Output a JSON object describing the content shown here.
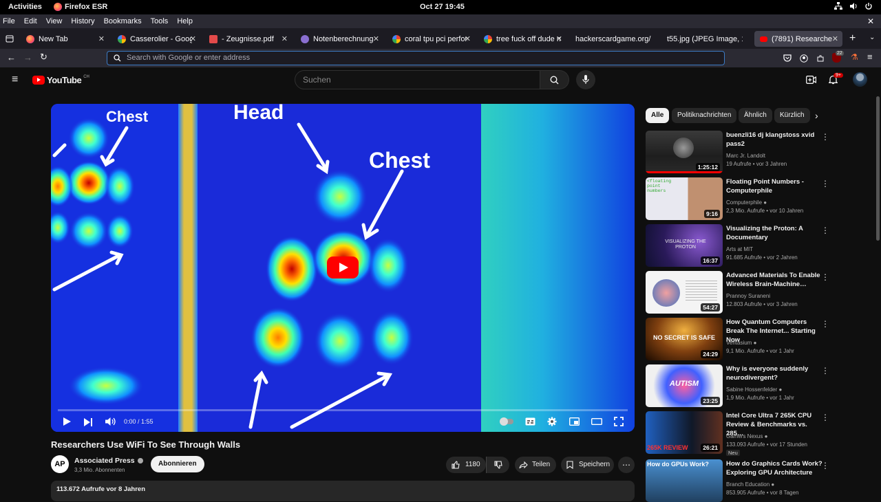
{
  "system": {
    "activities": "Activities",
    "app_name": "Firefox ESR",
    "clock": "Oct 27  19:45"
  },
  "menu": [
    "File",
    "Edit",
    "View",
    "History",
    "Bookmarks",
    "Tools",
    "Help"
  ],
  "tabs": [
    {
      "title": "New Tab"
    },
    {
      "title": "Casserolier - Google S"
    },
    {
      "title": "- Zeugnisse.pdf"
    },
    {
      "title": "Notenberechnung na"
    },
    {
      "title": "coral tpu pci perform"
    },
    {
      "title": "tree fuck off dude me"
    },
    {
      "title": "hackerscardgame.org/1/j"
    },
    {
      "title": "t55.jpg (JPEG Image, 160"
    },
    {
      "title": "(7891) Researchers U"
    }
  ],
  "nav": {
    "url_placeholder": "Search with Google or enter address",
    "notification_count": "22"
  },
  "youtube": {
    "logo": "YouTube",
    "region": "CH",
    "search_placeholder": "Suchen",
    "notif_badge": "9+",
    "video": {
      "title": "Researchers Use WiFi To See Through Walls",
      "time": "0:00 / 1:55",
      "overlay_labels": [
        "Chest",
        "Head",
        "Chest"
      ],
      "progress": 0
    },
    "channel": {
      "name": "Associated Press",
      "avatar_text": "AP",
      "subs": "3,3 Mio. Abonnenten",
      "subscribe": "Abonnieren"
    },
    "actions": {
      "likes": "1180",
      "share": "Teilen",
      "save": "Speichern"
    },
    "desc": {
      "views": "113.672 Aufrufe  vor 8 Jahren"
    },
    "chips": [
      "Alle",
      "Politiknachrichten",
      "Ähnlich",
      "Kürzlich"
    ],
    "recs": [
      {
        "title": "buenzli16 dj klangstoss xvid pass2",
        "channel": "Marc Jr. Landolt",
        "meta": "19 Aufrufe  • vor 3 Jahren",
        "duration": "1:25:12",
        "thumb_text": "",
        "verified": false,
        "badge": ""
      },
      {
        "title": "Floating Point Numbers - Computerphile",
        "channel": "Computerphile",
        "meta": "2,3 Mio. Aufrufe  • vor 10 Jahren",
        "duration": "9:16",
        "thumb_text": "<floating point numbers",
        "verified": true,
        "badge": ""
      },
      {
        "title": "Visualizing the Proton: A Documentary",
        "channel": "Arts at MIT",
        "meta": "91.685 Aufrufe  • vor 2 Jahren",
        "duration": "16:37",
        "thumb_text": "VISUALIZING THE PROTON",
        "verified": false,
        "badge": ""
      },
      {
        "title": "Advanced Materials To Enable Wireless Brain-Machine…",
        "channel": "Prannoy Suraneni",
        "meta": "12.803 Aufrufe  • vor 3 Jahren",
        "duration": "54:27",
        "thumb_text": "",
        "verified": false,
        "badge": ""
      },
      {
        "title": "How Quantum Computers Break The Internet... Starting Now",
        "channel": "Veritasium",
        "meta": "9,1 Mio. Aufrufe  • vor 1 Jahr",
        "duration": "24:29",
        "thumb_text": "NO SECRET IS SAFE",
        "verified": true,
        "badge": ""
      },
      {
        "title": "Why is everyone suddenly neurodivergent?",
        "channel": "Sabine Hossenfelder",
        "meta": "1,9 Mio. Aufrufe  • vor 1 Jahr",
        "duration": "23:25",
        "thumb_text": "AUTISM",
        "verified": true,
        "badge": ""
      },
      {
        "title": "Intel Core Ultra 7 265K CPU Review & Benchmarks vs. 285…",
        "channel": "Gamers Nexus",
        "meta": "133.093 Aufrufe  • vor 17 Stunden",
        "duration": "26:21",
        "thumb_text": "265K REVIEW",
        "verified": true,
        "badge": "Neu"
      },
      {
        "title": "How do Graphics Cards Work? Exploring GPU Architecture",
        "channel": "Branch Education",
        "meta": "853.905 Aufrufe  • vor 8 Tagen",
        "duration": "",
        "thumb_text": "How do GPUs Work?",
        "verified": true,
        "badge": ""
      }
    ]
  },
  "colors": {
    "yt_red": "#ff0000",
    "bg": "#0f0f0f",
    "chip": "#272727",
    "accent_blue": "#3c7cc6"
  }
}
